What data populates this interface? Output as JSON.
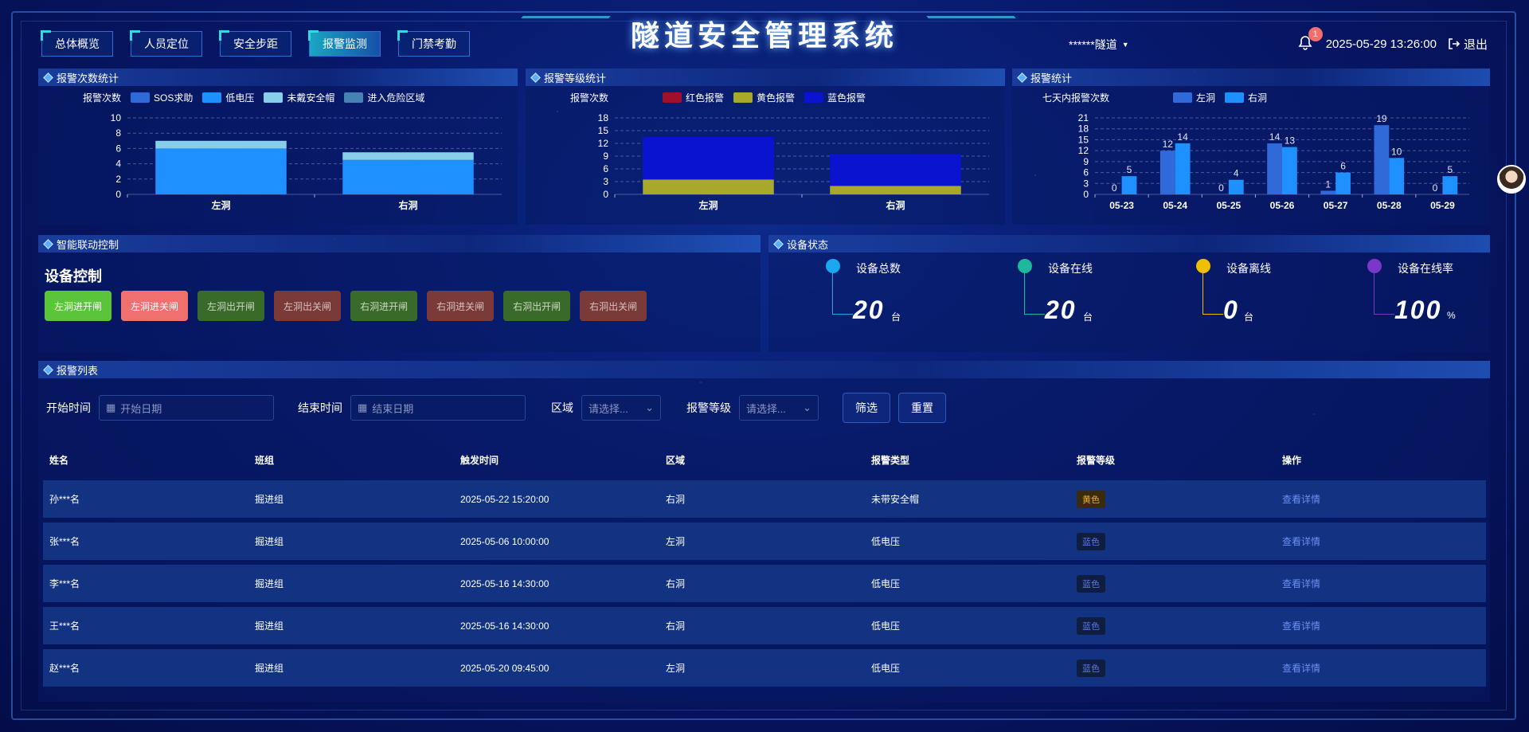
{
  "header": {
    "title": "隧道安全管理系统",
    "tabs": [
      "总体概览",
      "人员定位",
      "安全步距",
      "报警监测",
      "门禁考勤"
    ],
    "active_tab": 3,
    "tunnel": "******隧道",
    "notif_count": "1",
    "datetime": "2025-05-29 13:26:00",
    "logout": "退出"
  },
  "panels": {
    "count": "报警次数统计",
    "level": "报警等级统计",
    "alarm": "报警统计",
    "linkage": "智能联动控制",
    "device": "设备状态",
    "list": "报警列表"
  },
  "colors": {
    "sos": "#2f6ad8",
    "low": "#1e90ff",
    "helmet": "#87ceeb",
    "danger": "#4682b4",
    "red": "#a0102a",
    "yellow": "#a8a82a",
    "blue": "#0a14d0",
    "left": "#2f6ad8",
    "right": "#1e90ff"
  },
  "chart_data": [
    {
      "type": "bar",
      "stacked": true,
      "ylabel": "报警次数",
      "categories": [
        "左洞",
        "右洞"
      ],
      "yticks": [
        0,
        2,
        4,
        6,
        8,
        10
      ],
      "ylim": [
        0,
        10
      ],
      "series": [
        {
          "name": "SOS求助",
          "values": [
            0,
            0
          ]
        },
        {
          "name": "低电压",
          "values": [
            6,
            4.5
          ]
        },
        {
          "name": "未戴安全帽",
          "values": [
            1,
            1
          ]
        },
        {
          "name": "进入危险区域",
          "values": [
            0,
            0
          ]
        }
      ]
    },
    {
      "type": "bar",
      "stacked": true,
      "ylabel": "报警次数",
      "categories": [
        "左洞",
        "右洞"
      ],
      "yticks": [
        0,
        3,
        6,
        9,
        12,
        15,
        18
      ],
      "ylim": [
        0,
        18
      ],
      "series": [
        {
          "name": "红色报警",
          "values": [
            0,
            0
          ]
        },
        {
          "name": "黄色报警",
          "values": [
            3.5,
            2
          ]
        },
        {
          "name": "蓝色报警",
          "values": [
            10,
            7.5
          ]
        }
      ]
    },
    {
      "type": "bar",
      "ylabel": "七天内报警次数",
      "categories": [
        "05-23",
        "05-24",
        "05-25",
        "05-26",
        "05-27",
        "05-28",
        "05-29"
      ],
      "yticks": [
        0,
        3,
        6,
        9,
        12,
        15,
        18,
        21
      ],
      "ylim": [
        0,
        21
      ],
      "series": [
        {
          "name": "左洞",
          "values": [
            0,
            12,
            0,
            14,
            1,
            19,
            0
          ]
        },
        {
          "name": "右洞",
          "values": [
            5,
            14,
            4,
            13,
            6,
            10,
            5
          ]
        }
      ]
    }
  ],
  "device_control": {
    "title": "设备控制",
    "buttons": [
      "左洞进开闸",
      "左洞进关闸",
      "左洞出开闸",
      "左洞出关闸",
      "右洞进开闸",
      "右洞进关闸",
      "右洞出开闸",
      "右洞出关闸"
    ]
  },
  "device_stats": [
    {
      "label": "设备总数",
      "value": "20",
      "unit": "台",
      "color": "#1aa8f0"
    },
    {
      "label": "设备在线",
      "value": "20",
      "unit": "台",
      "color": "#1fb89a"
    },
    {
      "label": "设备离线",
      "value": "0",
      "unit": "台",
      "color": "#f0c000"
    },
    {
      "label": "设备在线率",
      "value": "100",
      "unit": "%",
      "color": "#7a38c8"
    }
  ],
  "filters": {
    "start_label": "开始时间",
    "start_ph": "开始日期",
    "end_label": "结束时间",
    "end_ph": "结束日期",
    "area_label": "区域",
    "area_ph": "请选择...",
    "level_label": "报警等级",
    "level_ph": "请选择...",
    "filter_btn": "筛选",
    "reset_btn": "重置"
  },
  "table": {
    "headers": [
      "姓名",
      "班组",
      "触发时间",
      "区域",
      "报警类型",
      "报警等级",
      "操作"
    ],
    "rows": [
      [
        "孙***名",
        "掘进组",
        "2025-05-22 15:20:00",
        "右洞",
        "未带安全帽",
        "黄色",
        "查看详情"
      ],
      [
        "张***名",
        "掘进组",
        "2025-05-06 10:00:00",
        "左洞",
        "低电压",
        "蓝色",
        "查看详情"
      ],
      [
        "李***名",
        "掘进组",
        "2025-05-16 14:30:00",
        "右洞",
        "低电压",
        "蓝色",
        "查看详情"
      ],
      [
        "王***名",
        "掘进组",
        "2025-05-16 14:30:00",
        "右洞",
        "低电压",
        "蓝色",
        "查看详情"
      ],
      [
        "赵***名",
        "掘进组",
        "2025-05-20 09:45:00",
        "左洞",
        "低电压",
        "蓝色",
        "查看详情"
      ]
    ]
  }
}
